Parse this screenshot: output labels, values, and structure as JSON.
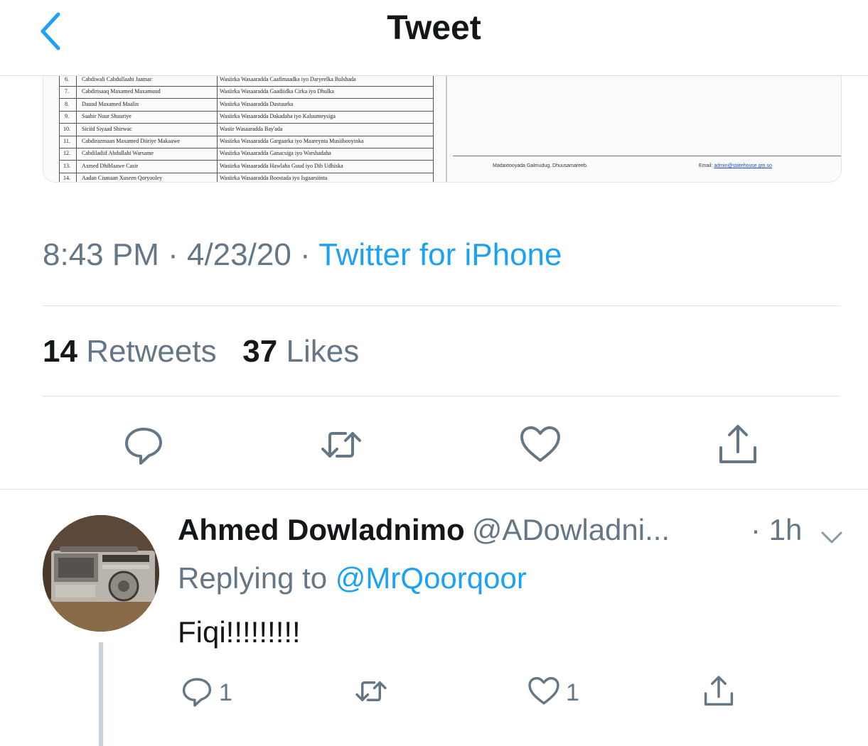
{
  "header": {
    "title": "Tweet",
    "back_icon": "chevron-left-icon"
  },
  "embedded_document": {
    "rows": [
      {
        "num": "6.",
        "name": "Cabdiwali Cabdullaahi Jaamac",
        "role": "Wasiirka Wasaaradda Caafimaadka iyo Daryeelka Bulshada"
      },
      {
        "num": "7.",
        "name": "Cabdirisaaq Maxamed Maxamuud",
        "role": "Wasiirka Wasaaradda Gaadiidka Cirka iyo Dhulka"
      },
      {
        "num": "8.",
        "name": "Dauud Maxamed Maalin",
        "role": "Wasiirka Wasaaradda Dastuurka"
      },
      {
        "num": "9.",
        "name": "Saabir Nuur Shuuriye",
        "role": "Wasiirka Wasaaradda Dakadaha iyo Kaluumeysiga"
      },
      {
        "num": "10.",
        "name": "Siciid Siyaad Shirwac",
        "role": "Wasiir Wasaaradda Bay'ada"
      },
      {
        "num": "11.",
        "name": "Cabdirazmaan Maxamed Diiriye Makaawe",
        "role": "Wasiirka Wasaaradda Gargaarka iyo Maareynta Musiibooyinka"
      },
      {
        "num": "12.",
        "name": "Cabdiladiif Abdullahi Warsame",
        "role": "Wasiirka Wasaaradda Ganacsiga iyo Warshadaha"
      },
      {
        "num": "13.",
        "name": "Axmed Dhiblaawe Casir",
        "role": "Wasiirka Wasaaradda Hawlaha Guud iyo Dib Udhiska"
      },
      {
        "num": "14.",
        "name": "Aadan Cismaan Xuseen Qoryooley",
        "role": "Wasiirka Wasaaradda Boostada iyo Isgaarsiinta"
      }
    ],
    "footer_left": "Madaxtooyada Galmudug, Dhuusamareeb.",
    "footer_email_label": "Email:",
    "footer_email": "admin@statehouse.gm.so"
  },
  "tweet_meta": {
    "time": "8:43 PM",
    "sep1": " · ",
    "date": "4/23/20",
    "sep2": " · ",
    "source": "Twitter for iPhone"
  },
  "stats": {
    "retweets_count": "14",
    "retweets_label": "Retweets",
    "likes_count": "37",
    "likes_label": "Likes"
  },
  "actions": {
    "reply_icon": "reply-icon",
    "retweet_icon": "retweet-icon",
    "like_icon": "heart-icon",
    "share_icon": "share-icon"
  },
  "reply": {
    "name": "Ahmed Dowladnimo",
    "handle": "@ADowladni...",
    "time": "· 1h",
    "replying_to_prefix": "Replying to",
    "replying_to_handle": "@MrQoorqoor",
    "text": "Fiqi!!!!!!!!!",
    "reply_count": "1",
    "like_count": "1",
    "avatar_description_icon": "avatar"
  },
  "colors": {
    "accent": "#1da1f2",
    "text_primary": "#14171a",
    "text_secondary": "#657786",
    "divider": "#dcdfe2"
  }
}
